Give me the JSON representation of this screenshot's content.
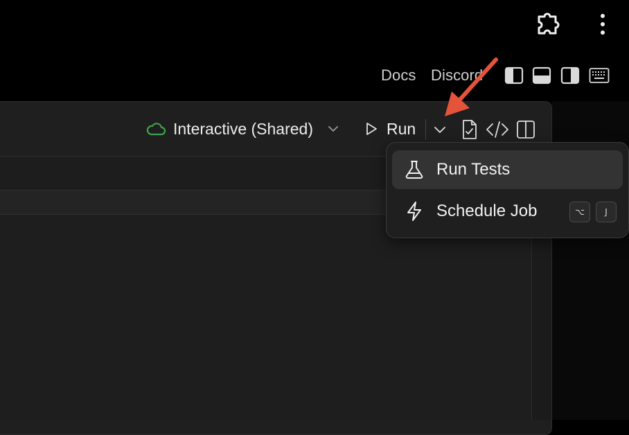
{
  "browser": {
    "icons": [
      "puzzle-extension-icon",
      "more-vertical-icon"
    ]
  },
  "header": {
    "links": {
      "docs": "Docs",
      "discord": "Discord"
    },
    "layout_icons": [
      "layout-sidebar-left-icon",
      "layout-panel-bottom-icon",
      "layout-sidebar-right-icon",
      "keyboard-icon"
    ]
  },
  "toolbar": {
    "compute_label": "Interactive (Shared)",
    "compute_status_color": "#3fa34d",
    "run_label": "Run",
    "icons": [
      "cloud-icon",
      "chevron-down-icon",
      "play-icon",
      "chevron-down-icon",
      "file-check-icon",
      "code-icon",
      "split-view-icon"
    ]
  },
  "dropdown": {
    "items": [
      {
        "label": "Run Tests",
        "icon": "flask-icon",
        "highlighted": true
      },
      {
        "label": "Schedule Job",
        "icon": "lightning-icon",
        "shortcut": [
          "⌥",
          "J"
        ]
      }
    ]
  },
  "annotation": {
    "arrow_color": "#e5533b"
  }
}
